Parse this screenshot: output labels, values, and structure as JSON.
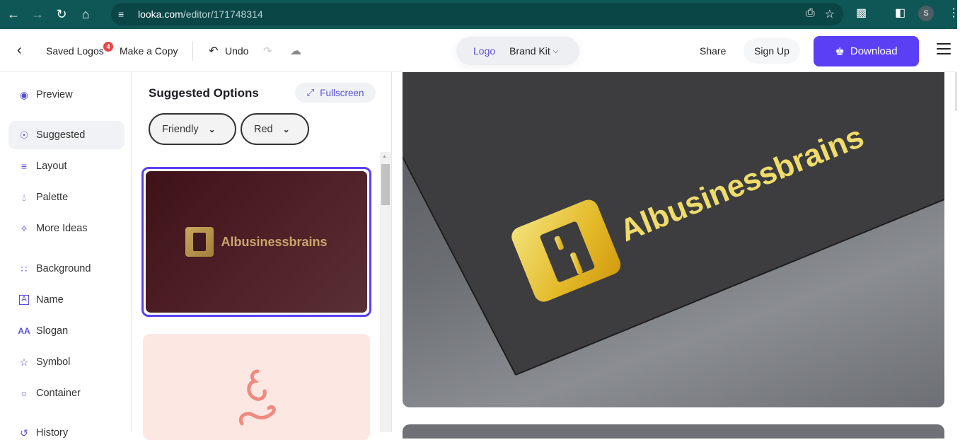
{
  "browser": {
    "url_host": "looka.com",
    "url_path": "/editor/171748314",
    "profile_initial": "S",
    "icons": [
      "back-icon",
      "forward-icon",
      "reload-icon",
      "home-icon",
      "site-settings-icon",
      "install-app-icon",
      "bookmark-star-icon",
      "extensions-icon",
      "side-panel-icon",
      "kebab-menu-icon"
    ]
  },
  "topbar": {
    "saved_logos": "Saved Logos",
    "saved_logos_count": "4",
    "make_copy": "Make a Copy",
    "undo": "Undo",
    "tabs": {
      "logo": "Logo",
      "brand_kit": "Brand Kit"
    },
    "share": "Share",
    "sign_up": "Sign Up",
    "download": "Download",
    "accent_color": "#5b3ff5"
  },
  "sidebar": {
    "items": [
      {
        "label": "Preview",
        "icon": "eye-icon"
      },
      {
        "label": "Suggested",
        "icon": "lightbulb-icon",
        "active": true
      },
      {
        "label": "Layout",
        "icon": "layers-icon"
      },
      {
        "label": "Palette",
        "icon": "droplet-icon"
      },
      {
        "label": "More Ideas",
        "icon": "magic-wand-icon"
      },
      {
        "label": "Background",
        "icon": "background-grid-icon"
      },
      {
        "label": "Name",
        "icon": "name-text-icon"
      },
      {
        "label": "Slogan",
        "icon": "slogan-text-icon"
      },
      {
        "label": "Symbol",
        "icon": "star-icon"
      },
      {
        "label": "Container",
        "icon": "circle-icon"
      },
      {
        "label": "History",
        "icon": "history-icon"
      }
    ]
  },
  "panel": {
    "title": "Suggested Options",
    "fullscreen": "Fullscreen",
    "filters": [
      {
        "label": "Friendly"
      },
      {
        "label": "Red"
      }
    ],
    "cards": [
      {
        "brand": "Albusinessbrains",
        "selected": true,
        "background": "#4a1b22"
      },
      {
        "brand": "",
        "selected": false,
        "background": "#fde7e3"
      }
    ]
  },
  "preview": {
    "brand": "Albusinessbrains"
  }
}
